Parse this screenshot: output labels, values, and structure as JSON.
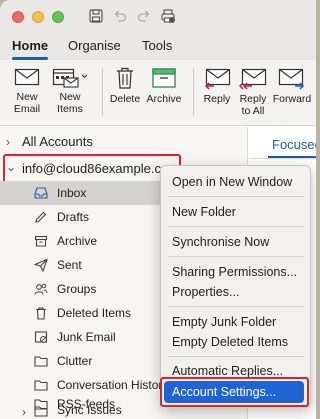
{
  "tabs": [
    {
      "label": "Home"
    },
    {
      "label": "Organise"
    },
    {
      "label": "Tools"
    }
  ],
  "ribbon": {
    "new_email": "New\nEmail",
    "new_items": "New\nItems",
    "delete": "Delete",
    "archive": "Archive",
    "reply": "Reply",
    "reply_all": "Reply\nto All",
    "forward": "Forward"
  },
  "folders": {
    "all_accounts": "All Accounts",
    "account": "info@cloud86example.com",
    "items": [
      {
        "label": "Inbox",
        "icon": "inbox-icon"
      },
      {
        "label": "Drafts",
        "icon": "drafts-icon"
      },
      {
        "label": "Archive",
        "icon": "archive-icon"
      },
      {
        "label": "Sent",
        "icon": "sent-icon"
      },
      {
        "label": "Groups",
        "icon": "groups-icon"
      },
      {
        "label": "Deleted Items",
        "icon": "trash-icon"
      },
      {
        "label": "Junk Email",
        "icon": "junk-icon"
      },
      {
        "label": "Clutter",
        "icon": "folder-icon"
      },
      {
        "label": "Conversation History",
        "icon": "folder-icon"
      },
      {
        "label": "RSS-feeds",
        "icon": "folder-icon"
      },
      {
        "label": "Sync Issues",
        "icon": "folder-icon"
      }
    ]
  },
  "message_pane": {
    "focused": "Focused"
  },
  "context_menu": {
    "items": [
      "Open in New Window",
      "New Folder",
      "Synchronise Now",
      "Sharing Permissions...",
      "Properties...",
      "Empty Junk Folder",
      "Empty Deleted Items",
      "Automatic Replies...",
      "Account Settings..."
    ],
    "highlighted": "Account Settings..."
  },
  "colors": {
    "accent": "#1a5fb4",
    "highlight_red": "#e0242b",
    "menu_selection": "#1f63d6"
  }
}
